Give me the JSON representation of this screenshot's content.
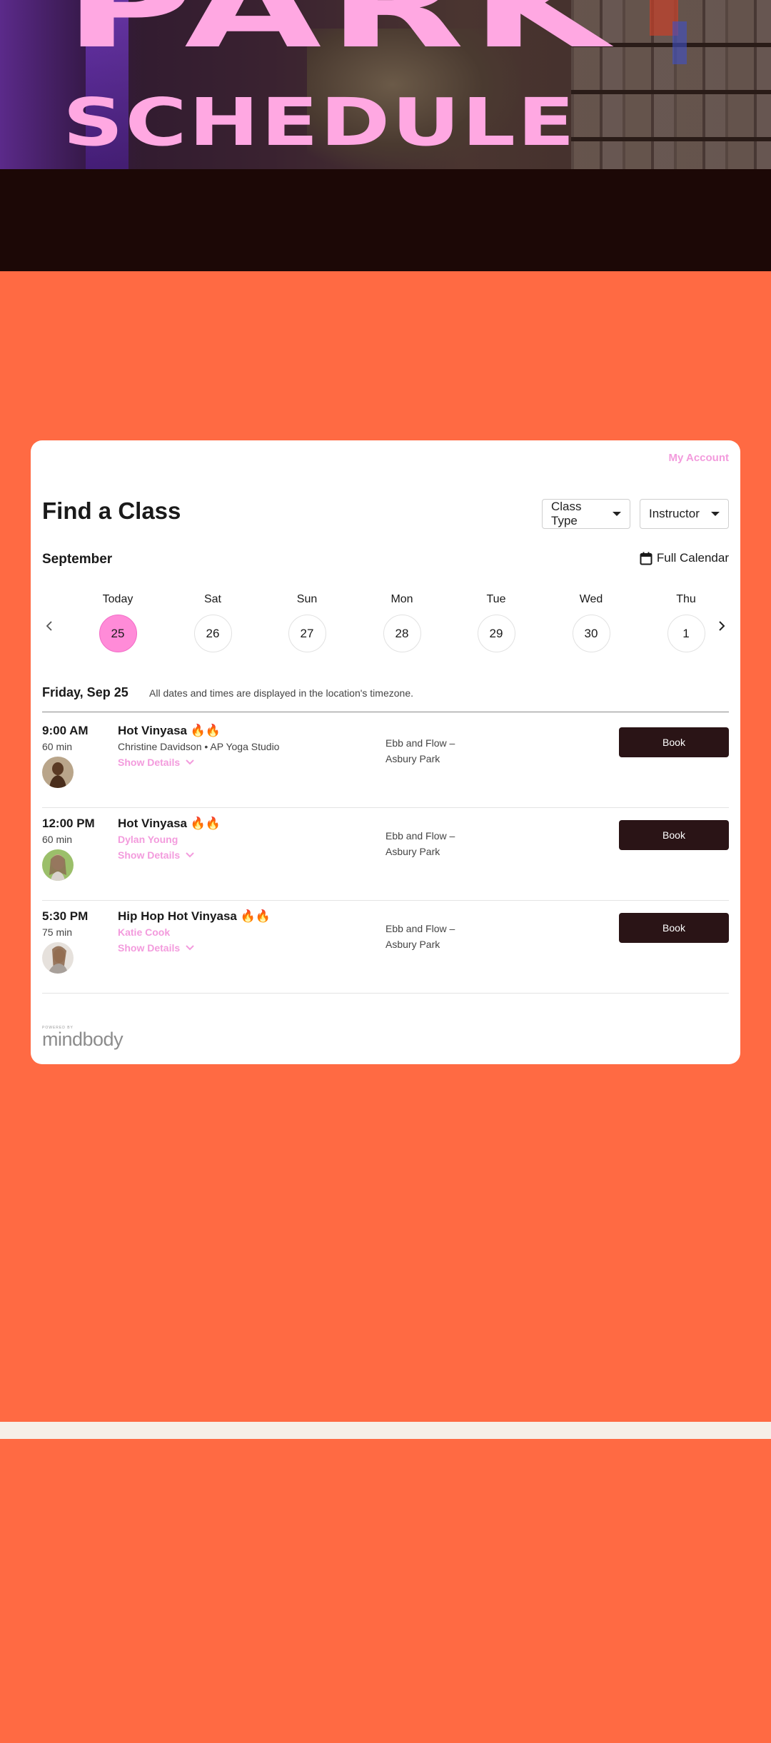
{
  "hero": {
    "title_line1": "PARK",
    "title_line2": "SCHEDULE"
  },
  "widget": {
    "my_account": "My Account",
    "title": "Find a Class",
    "filters": {
      "class_type": "Class Type",
      "instructor": "Instructor"
    },
    "month": "September",
    "full_calendar": "Full Calendar",
    "days": [
      {
        "name": "Today",
        "num": "25",
        "selected": true
      },
      {
        "name": "Sat",
        "num": "26"
      },
      {
        "name": "Sun",
        "num": "27"
      },
      {
        "name": "Mon",
        "num": "28"
      },
      {
        "name": "Tue",
        "num": "29"
      },
      {
        "name": "Wed",
        "num": "30"
      },
      {
        "name": "Thu",
        "num": "1"
      }
    ],
    "date_heading": "Friday, Sep 25",
    "tz_note": "All dates and times are displayed in the location's timezone.",
    "classes": [
      {
        "time": "9:00 AM",
        "duration": "60 min",
        "name": "Hot Vinyasa",
        "fire": "🔥🔥",
        "instructor": "Christine Davidson • AP Yoga Studio",
        "show_details": "Show Details",
        "location_1": "Ebb and Flow –",
        "location_2": "Asbury Park",
        "book": "Book"
      },
      {
        "time": "12:00 PM",
        "duration": "60 min",
        "name": "Hot Vinyasa",
        "fire": "🔥🔥",
        "instructor": "Dylan Young",
        "show_details": "Show Details",
        "location_1": "Ebb and Flow –",
        "location_2": "Asbury Park",
        "book": "Book"
      },
      {
        "time": "5:30 PM",
        "duration": "75 min",
        "name": "Hip Hop Hot Vinyasa",
        "fire": "🔥🔥",
        "instructor": "Katie Cook",
        "show_details": "Show Details",
        "location_1": "Ebb and Flow –",
        "location_2": "Asbury Park",
        "book": "Book"
      }
    ],
    "powered_by": "POWERED BY",
    "brand": "mindbody"
  },
  "colors": {
    "page_bg": "#FF6A43",
    "accent_pink": "#FF8BD8",
    "book_button": "#2A1416",
    "dark_band": "#1C0806"
  },
  "icons": [
    "calendar-icon",
    "chevron-left-icon",
    "chevron-right-icon",
    "chevron-down-icon",
    "caret-down-icon"
  ]
}
